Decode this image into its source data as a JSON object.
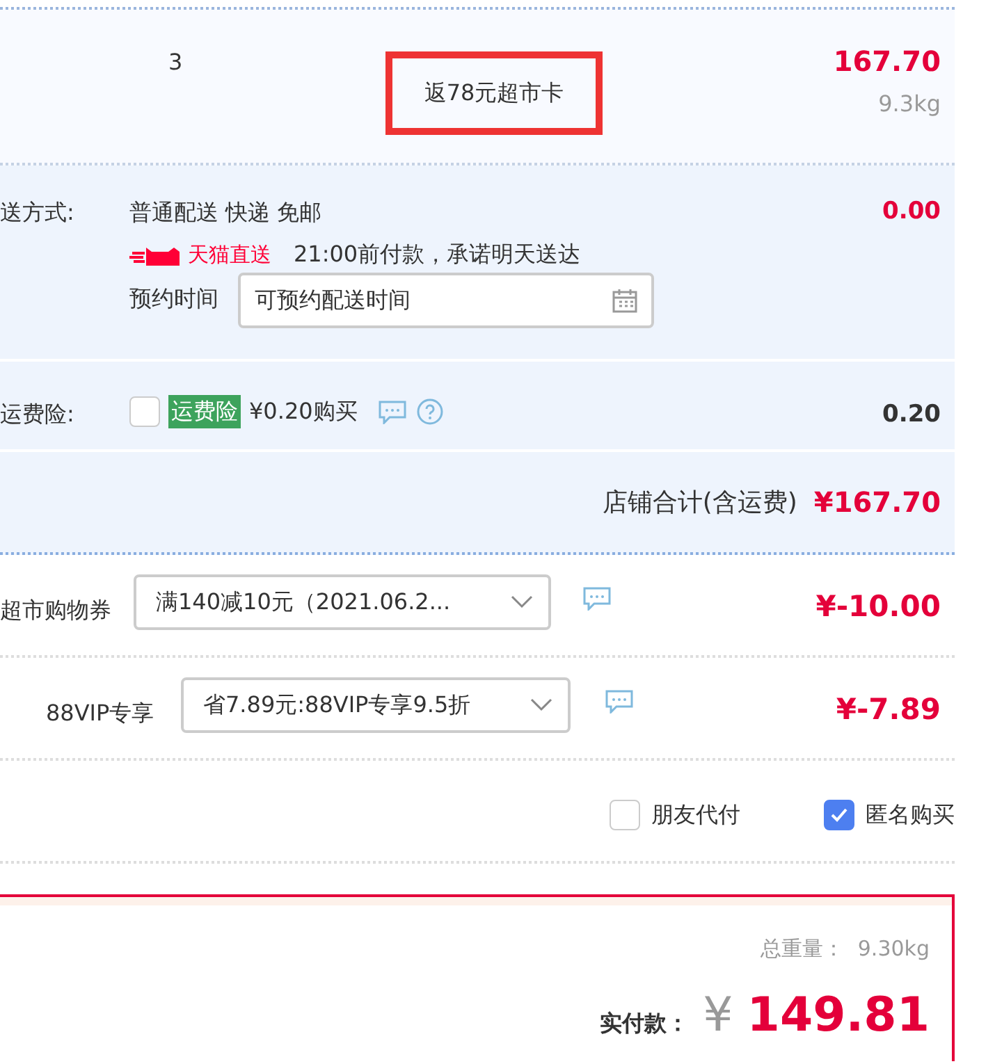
{
  "item": {
    "quantity": "3",
    "promo_tag": "返78元超市卡",
    "price": "167.70",
    "weight": "9.3kg"
  },
  "shipping": {
    "label": "送方式:",
    "method": "普通配送 快递 免邮",
    "service_badge": "天猫直送",
    "promise": "21:00前付款，承诺明天送达",
    "schedule_label": "预约时间",
    "schedule_placeholder": "可预约配送时间",
    "amount": "0.00"
  },
  "insurance": {
    "label": "运费险:",
    "checked": false,
    "tag": "运费险",
    "offer": "¥0.20购买",
    "amount": "0.20"
  },
  "store_total": {
    "label": "店铺合计(含运费)",
    "amount": "¥167.70"
  },
  "discounts": [
    {
      "label": "超市购物券",
      "value": "满140减10元（2021.06.2...",
      "amount": "¥-10.00"
    },
    {
      "label": "88VIP专享",
      "value": "省7.89元:88VIP专享9.5折",
      "amount": "¥-7.89"
    }
  ],
  "options": [
    {
      "label": "朋友代付",
      "checked": false
    },
    {
      "label": "匿名购买",
      "checked": true
    }
  ],
  "summary": {
    "weight_label": "总重量：",
    "weight": "9.30kg",
    "pay_label": "实付款：",
    "currency": "¥",
    "total": "149.81"
  }
}
